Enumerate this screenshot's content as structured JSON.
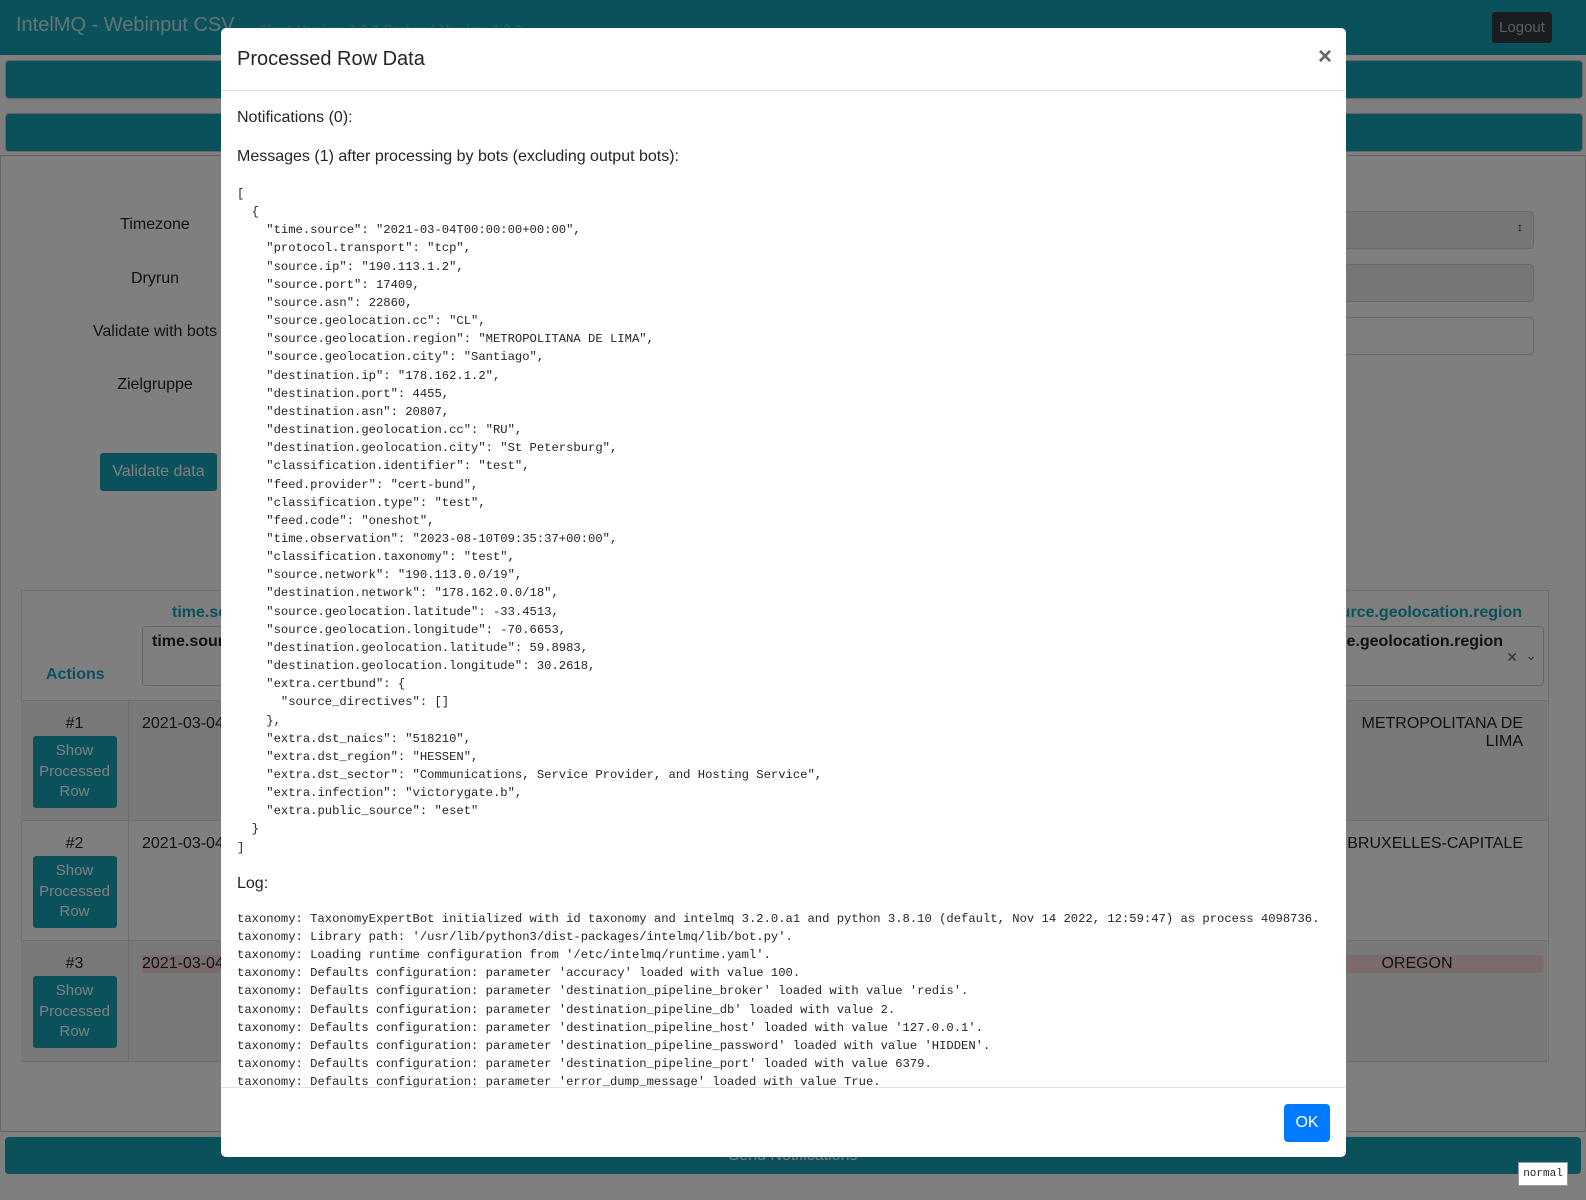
{
  "header": {
    "app_title": "IntelMQ - Webinput CSV",
    "versions": "Client Version: 1.0.2    Backend Version: 1.0.2",
    "logout_label": "Logout"
  },
  "form": {
    "timezone_label": "Timezone",
    "dryrun_label": "Dryrun",
    "validate_bots_label": "Validate with bots",
    "zielgruppe_label": "Zielgruppe",
    "validate_button": "Validate data"
  },
  "table": {
    "actions_header": "Actions",
    "col_time_header": "time.source",
    "col_time_filter": "time.source",
    "col_region_header": "source.geolocation.region",
    "col_region_filter": "source.geolocation.region",
    "show_button": "Show Processed Row",
    "rows": [
      {
        "num": "#1",
        "time": "2021-03-04",
        "region": "METROPOLITANA DE LIMA"
      },
      {
        "num": "#2",
        "time": "2021-03-04",
        "region": "BRUXELLES-CAPITALE"
      },
      {
        "num": "#3",
        "time": "2021-03-04",
        "region": "OREGON"
      }
    ]
  },
  "send_notifications": "Send Notifications",
  "mode_badge": "normal",
  "modal": {
    "title": "Processed Row Data",
    "close": "×",
    "notifications": "Notifications (0):",
    "messages_heading": "Messages (1) after processing by bots (excluding output bots):",
    "messages_json": "[\n  {\n    \"time.source\": \"2021-03-04T00:00:00+00:00\",\n    \"protocol.transport\": \"tcp\",\n    \"source.ip\": \"190.113.1.2\",\n    \"source.port\": 17409,\n    \"source.asn\": 22860,\n    \"source.geolocation.cc\": \"CL\",\n    \"source.geolocation.region\": \"METROPOLITANA DE LIMA\",\n    \"source.geolocation.city\": \"Santiago\",\n    \"destination.ip\": \"178.162.1.2\",\n    \"destination.port\": 4455,\n    \"destination.asn\": 20807,\n    \"destination.geolocation.cc\": \"RU\",\n    \"destination.geolocation.city\": \"St Petersburg\",\n    \"classification.identifier\": \"test\",\n    \"feed.provider\": \"cert-bund\",\n    \"classification.type\": \"test\",\n    \"feed.code\": \"oneshot\",\n    \"time.observation\": \"2023-08-10T09:35:37+00:00\",\n    \"classification.taxonomy\": \"test\",\n    \"source.network\": \"190.113.0.0/19\",\n    \"destination.network\": \"178.162.0.0/18\",\n    \"source.geolocation.latitude\": -33.4513,\n    \"source.geolocation.longitude\": -70.6653,\n    \"destination.geolocation.latitude\": 59.8983,\n    \"destination.geolocation.longitude\": 30.2618,\n    \"extra.certbund\": {\n      \"source_directives\": []\n    },\n    \"extra.dst_naics\": \"518210\",\n    \"extra.dst_region\": \"HESSEN\",\n    \"extra.dst_sector\": \"Communications, Service Provider, and Hosting Service\",\n    \"extra.infection\": \"victorygate.b\",\n    \"extra.public_source\": \"eset\"\n  }\n]",
    "log_heading": "Log:",
    "log_text": "taxonomy: TaxonomyExpertBot initialized with id taxonomy and intelmq 3.2.0.a1 and python 3.8.10 (default, Nov 14 2022, 12:59:47) as process 4098736.\ntaxonomy: Library path: '/usr/lib/python3/dist-packages/intelmq/lib/bot.py'.\ntaxonomy: Loading runtime configuration from '/etc/intelmq/runtime.yaml'.\ntaxonomy: Defaults configuration: parameter 'accuracy' loaded with value 100.\ntaxonomy: Defaults configuration: parameter 'destination_pipeline_broker' loaded with value 'redis'.\ntaxonomy: Defaults configuration: parameter 'destination_pipeline_db' loaded with value 2.\ntaxonomy: Defaults configuration: parameter 'destination_pipeline_host' loaded with value '127.0.0.1'.\ntaxonomy: Defaults configuration: parameter 'destination_pipeline_password' loaded with value 'HIDDEN'.\ntaxonomy: Defaults configuration: parameter 'destination_pipeline_port' loaded with value 6379.\ntaxonomy: Defaults configuration: parameter 'error_dump_message' loaded with value True.",
    "ok_label": "OK"
  }
}
